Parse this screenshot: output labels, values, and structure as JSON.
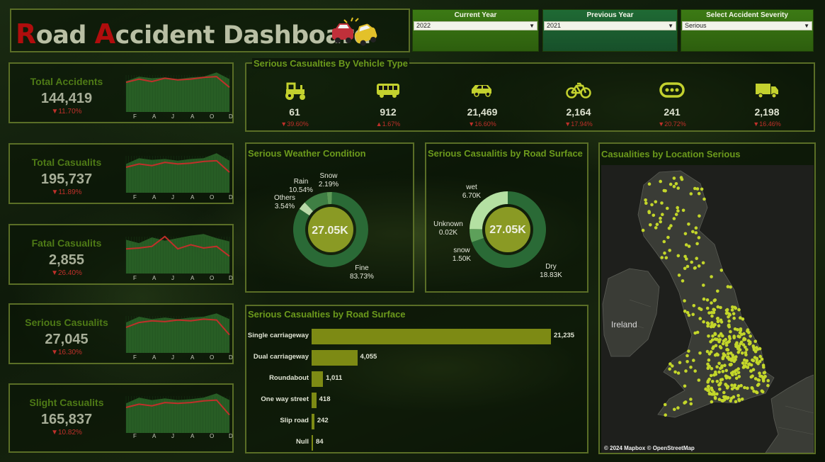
{
  "header": {
    "title_first_cap": "R",
    "title_rest_1": "oad ",
    "title_second_cap": "A",
    "title_rest_2": "ccident Dashboard",
    "icon": "car-crash-icon"
  },
  "filters": [
    {
      "label": "Current Year",
      "value": "2022"
    },
    {
      "label": "Previous Year",
      "value": "2021"
    },
    {
      "label": "Select Accident Severity",
      "value": "Serious"
    }
  ],
  "kpis": [
    {
      "label": "Total Accidents",
      "value": "144,419",
      "change": "▼11.70%",
      "trend_cy": [
        0.72,
        0.8,
        0.74,
        0.82,
        0.78,
        0.8,
        0.84,
        0.86,
        0.6
      ],
      "trend_area": [
        0.75,
        0.86,
        0.82,
        0.84,
        0.8,
        0.84,
        0.86,
        0.96,
        0.8
      ]
    },
    {
      "label": "Total Casualits",
      "value": "195,737",
      "change": "▼11.89%",
      "trend_cy": [
        0.62,
        0.7,
        0.66,
        0.74,
        0.7,
        0.72,
        0.76,
        0.78,
        0.5
      ],
      "trend_area": [
        0.7,
        0.84,
        0.8,
        0.82,
        0.78,
        0.82,
        0.84,
        0.96,
        0.78
      ]
    },
    {
      "label": "Fatal Casualits",
      "value": "2,855",
      "change": "▼26.40%",
      "trend_cy": [
        0.6,
        0.62,
        0.66,
        0.9,
        0.6,
        0.7,
        0.62,
        0.66,
        0.42
      ],
      "trend_area": [
        0.82,
        0.74,
        0.88,
        0.8,
        0.86,
        0.92,
        0.96,
        0.86,
        0.78
      ]
    },
    {
      "label": "Serious Casualits",
      "value": "27,045",
      "change": "▼16.30%",
      "trend_cy": [
        0.62,
        0.74,
        0.78,
        0.76,
        0.8,
        0.78,
        0.82,
        0.8,
        0.44
      ],
      "trend_area": [
        0.74,
        0.88,
        0.82,
        0.86,
        0.82,
        0.86,
        0.88,
        0.96,
        0.82
      ]
    },
    {
      "label": "Slight Casualits",
      "value": "165,837",
      "change": "▼10.82%",
      "trend_cy": [
        0.62,
        0.7,
        0.66,
        0.74,
        0.72,
        0.74,
        0.78,
        0.8,
        0.44
      ],
      "trend_area": [
        0.72,
        0.86,
        0.8,
        0.84,
        0.8,
        0.82,
        0.86,
        0.96,
        0.8
      ]
    }
  ],
  "months": [
    "F",
    "A",
    "J",
    "A",
    "O",
    "D"
  ],
  "vehicle_panel": {
    "title": "Serious Casualties By Vehicle Type",
    "items": [
      {
        "icon": "tractor-icon",
        "value": "61",
        "change": "▼39.60%"
      },
      {
        "icon": "bus-icon",
        "value": "912",
        "change": "▲1.67%"
      },
      {
        "icon": "car-icon",
        "value": "21,469",
        "change": "▼16.60%"
      },
      {
        "icon": "bicycle-icon",
        "value": "2,164",
        "change": "▼17.94%"
      },
      {
        "icon": "other-vehicle-icon",
        "value": "241",
        "change": "▼20.72%"
      },
      {
        "icon": "truck-icon",
        "value": "2,198",
        "change": "▼16.46%"
      }
    ]
  },
  "weather_panel": {
    "title": "Serious Weather Condition",
    "center": "27.05K",
    "slices": [
      {
        "name": "Fine",
        "pct": "83.73%",
        "value": 83.73,
        "color": "#2a6a36"
      },
      {
        "name": "Others",
        "pct": "3.54%",
        "value": 3.54,
        "color": "#b9d9a8"
      },
      {
        "name": "Rain",
        "pct": "10.54%",
        "value": 10.54,
        "color": "#3f7f44"
      },
      {
        "name": "Snow",
        "pct": "2.19%",
        "value": 2.19,
        "color": "#5d9b57"
      }
    ],
    "center_color": "#8a9a24"
  },
  "surface_donut_panel": {
    "title": "Serious Casualitis by Road Surface",
    "center": "27.05K",
    "slices": [
      {
        "name": "Dry",
        "amount": "18.83K",
        "value": 18.83,
        "color": "#2a6a36"
      },
      {
        "name": "snow",
        "amount": "1.50K",
        "value": 1.5,
        "color": "#5da05a"
      },
      {
        "name": "Unknown",
        "amount": "0.02K",
        "value": 0.02,
        "color": "#7fbf72"
      },
      {
        "name": "wet",
        "amount": "6.70K",
        "value": 6.7,
        "color": "#b4e0a2"
      }
    ],
    "center_color": "#8a9a24"
  },
  "bar_panel": {
    "title": "Serious Casualties by Road Surface",
    "bar_color": "#7d8a14",
    "items": [
      {
        "category": "Single carriageway",
        "value": 21235,
        "label": "21,235"
      },
      {
        "category": "Dual carriageway",
        "value": 4055,
        "label": "4,055"
      },
      {
        "category": "Roundabout",
        "value": 1011,
        "label": "1,011"
      },
      {
        "category": "One way street",
        "value": 418,
        "label": "418"
      },
      {
        "category": "Slip road",
        "value": 242,
        "label": "242"
      },
      {
        "category": "Null",
        "value": 84,
        "label": "84"
      }
    ]
  },
  "map_panel": {
    "title": "Casualities by Location Serious",
    "label_ireland": "Ireland",
    "attribution": "© 2024 Mapbox © OpenStreetMap",
    "dot_color": "#c3d62a"
  },
  "colors": {
    "accent_green": "#6c9a1c",
    "kpi_label": "#4e7a16",
    "negative_change": "#c0302a",
    "line_cy": "#c0302a",
    "area_py": "#2d6a2a"
  }
}
